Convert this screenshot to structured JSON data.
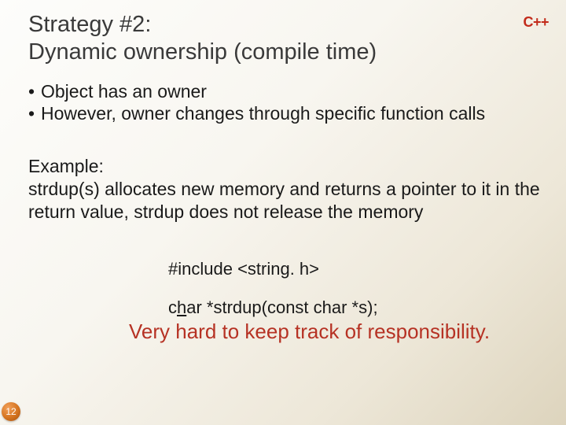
{
  "title_line1": "Strategy #2:",
  "title_line2": "Dynamic ownership (compile time)",
  "badge": "C++",
  "bullets": [
    "Object has an owner",
    "However, owner changes through specific function calls"
  ],
  "example": {
    "heading": "Example:",
    "body": "strdup(s) allocates new memory and returns a pointer to it in the return value, strdup does not release the memory"
  },
  "code": {
    "include": "#include <string. h>",
    "proto_pre": "c",
    "proto_ul": "h",
    "proto_post": "ar *strdup(const char *s);"
  },
  "footnote": "Very hard to keep track of responsibility.",
  "page_number": "12"
}
